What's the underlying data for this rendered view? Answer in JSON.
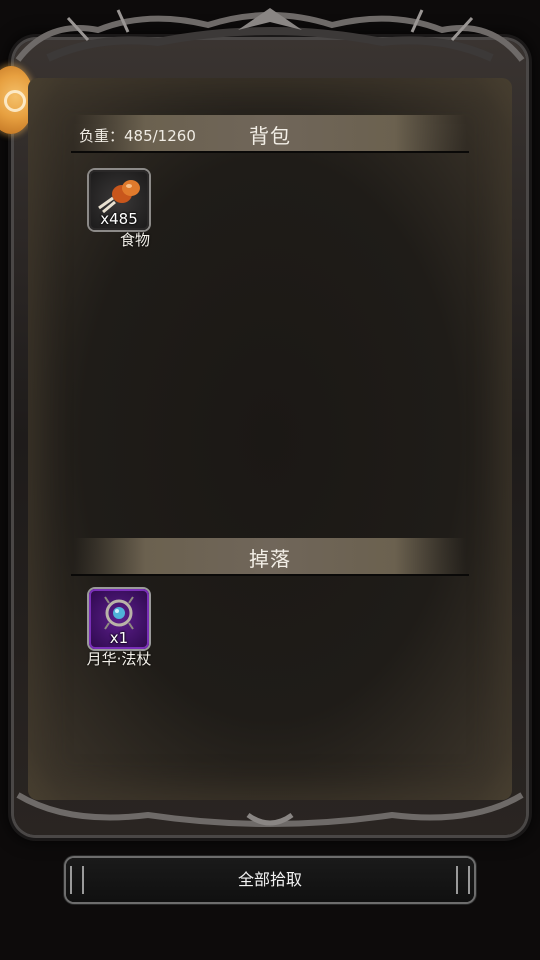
{
  "backpack": {
    "title": "背包",
    "weight_label": "负重：485/1260",
    "items": [
      {
        "name": "食物",
        "count": "x485",
        "icon": "food-icon"
      }
    ]
  },
  "drops": {
    "title": "掉落",
    "items": [
      {
        "name": "月华·法杖",
        "count": "x1",
        "icon": "staff-icon"
      }
    ]
  },
  "actions": {
    "pickup_all": "全部拾取"
  },
  "colors": {
    "panel": "#1f1c18",
    "header_bar": "#70665a",
    "staff_rarity": "#5d1f8c"
  }
}
